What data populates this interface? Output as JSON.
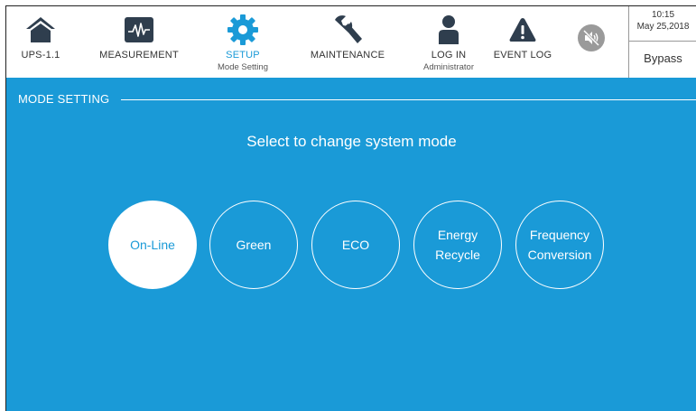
{
  "nav": {
    "items": [
      {
        "label": "UPS-1.1",
        "sub": ""
      },
      {
        "label": "MEASUREMENT",
        "sub": ""
      },
      {
        "label": "SETUP",
        "sub": "Mode Setting"
      },
      {
        "label": "MAINTENANCE",
        "sub": ""
      },
      {
        "label": "LOG IN",
        "sub": "Administrator"
      },
      {
        "label": "EVENT LOG",
        "sub": ""
      }
    ],
    "icons": [
      "home-icon",
      "waveform-icon",
      "gear-icon",
      "wrench-icon",
      "user-icon",
      "warning-icon",
      "mute-icon"
    ],
    "active_item": "SETUP"
  },
  "status": {
    "time": "10:15",
    "date": "May 25,2018",
    "mode": "Bypass"
  },
  "main": {
    "section_title": "MODE SETTING",
    "prompt": "Select to change system mode",
    "modes": [
      {
        "label": "On-Line",
        "selected": true
      },
      {
        "label": "Green",
        "selected": false
      },
      {
        "label": "ECO",
        "selected": false
      },
      {
        "label": "Energy\nRecycle",
        "selected": false
      },
      {
        "label": "Frequency\nConversion",
        "selected": false
      }
    ]
  },
  "colors": {
    "accent": "#1a9ad7",
    "icon_dark": "#2f3e4e",
    "mute_button": "#9a9a9a"
  }
}
